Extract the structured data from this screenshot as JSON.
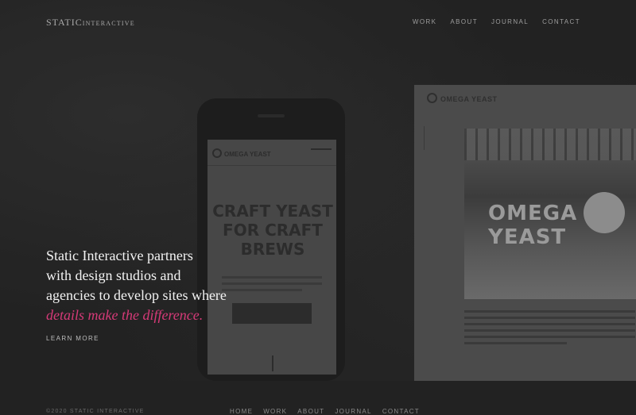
{
  "brand": {
    "logo_primary": "STATIC",
    "logo_secondary": "INTERACTIVE"
  },
  "nav": {
    "items": [
      "WORK",
      "ABOUT",
      "JOURNAL",
      "CONTACT"
    ]
  },
  "hero": {
    "line1": "Static Interactive partners",
    "line2": "with design studios and",
    "line3": "agencies to develop sites where",
    "accent": "details make the difference.",
    "cta": "LEARN MORE"
  },
  "mockups": {
    "tablet_logo": "OMEGA YEAST",
    "phone_logo": "OMEGA YEAST",
    "phone_headline": "CRAFT YEAST FOR CRAFT BREWS",
    "photo_sign": "OMEGA YEAST"
  },
  "footer": {
    "copyright": "©2020 STATIC INTERACTIVE",
    "nav": [
      "HOME",
      "WORK",
      "ABOUT",
      "JOURNAL",
      "CONTACT"
    ]
  },
  "colors": {
    "accent": "#d63a78",
    "background": "#232323",
    "text": "#f2f2f2"
  }
}
